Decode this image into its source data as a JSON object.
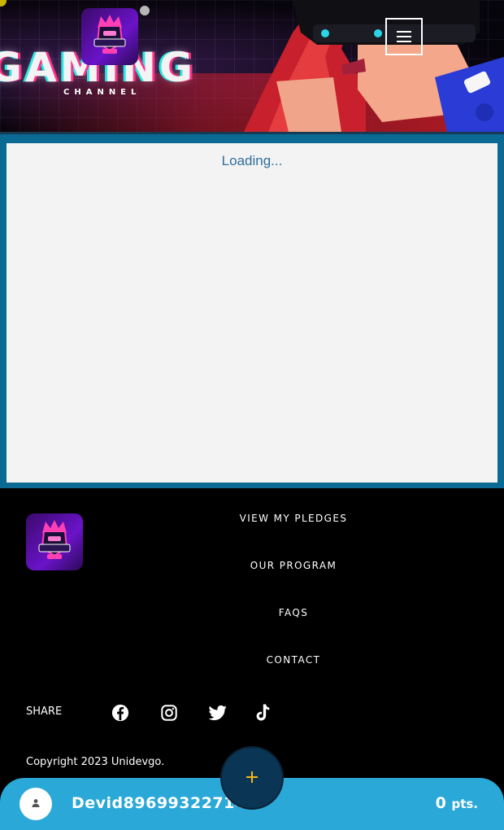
{
  "header": {
    "banner_title": "GAMING",
    "banner_subtitle": "CHANNEL",
    "logo_label": "GAMING",
    "menu_icon": "hamburger-menu-icon"
  },
  "main": {
    "loading_text": "Loading..."
  },
  "footer": {
    "logo_label": "GAMING",
    "nav": [
      {
        "label": "VIEW MY PLEDGES"
      },
      {
        "label": "OUR PROGRAM"
      },
      {
        "label": "FAQS"
      },
      {
        "label": "CONTACT"
      }
    ],
    "share_label": "SHARE",
    "social_icons": [
      "facebook-icon",
      "instagram-icon",
      "twitter-icon",
      "tiktok-icon"
    ],
    "copyright": "Copyright 2023 Unidevgo."
  },
  "user_bar": {
    "username": "Devid89699322714",
    "points_value": "0",
    "points_unit": "pts.",
    "add_icon": "plus-icon",
    "avatar_icon": "user-icon"
  },
  "colors": {
    "accent_blue": "#2aa8d8",
    "frame_blue": "#0a6a94",
    "fab_navy": "#0b3554",
    "fab_plus": "#f1b817",
    "loading_text": "#2f6f9c"
  }
}
